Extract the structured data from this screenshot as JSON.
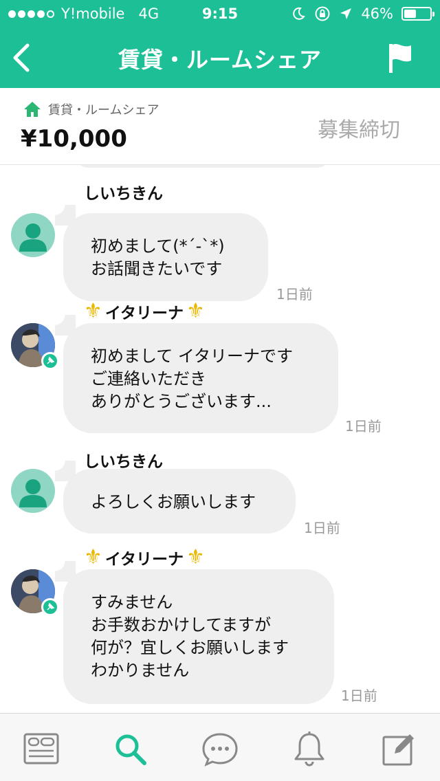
{
  "status_bar": {
    "carrier": "Y!mobile",
    "network": "4G",
    "time": "9:15",
    "battery": "46%",
    "battery_level": 0.46,
    "signal_bars_filled": 4,
    "signal_bars_total": 5
  },
  "nav": {
    "title": "賃貸・ルームシェア"
  },
  "listing": {
    "category": "賃貸・ルームシェア",
    "price": "¥10,000",
    "status": "募集締切"
  },
  "messages": [
    {
      "sender": "しいちきん",
      "decorated": false,
      "avatar": "default-user-icon",
      "text": "初めまして(*´-`*)\nお話聞きたいです",
      "time": "1日前"
    },
    {
      "sender": "イタリーナ",
      "decorated": true,
      "avatar": "profile-photo",
      "text": "初めまして イタリーナです\nご連絡いただき\nありがとうございます...",
      "time": "1日前"
    },
    {
      "sender": "しいちきん",
      "decorated": false,
      "avatar": "default-user-icon",
      "text": "よろしくお願いします",
      "time": "1日前"
    },
    {
      "sender": "イタリーナ",
      "decorated": true,
      "avatar": "profile-photo",
      "text": "すみません\nお手数おかけしてますが\n何が？宜しくお願いします\nわかりません",
      "time": "1日前"
    }
  ],
  "tabbar": {
    "items": [
      "feed-icon",
      "search-icon",
      "chat-icon",
      "bell-icon",
      "compose-icon"
    ],
    "active": "search-icon"
  },
  "colors": {
    "brand_green": "#1dbf97",
    "bubble_bg": "#efefef",
    "lily_gold": "#e8b800"
  }
}
